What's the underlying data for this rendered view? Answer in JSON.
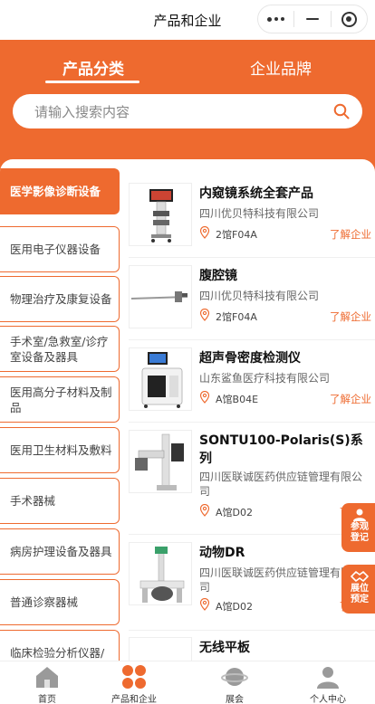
{
  "header": {
    "title": "产品和企业"
  },
  "tabs": {
    "products": "产品分类",
    "brands": "企业品牌"
  },
  "search": {
    "placeholder": "请输入搜索内容"
  },
  "categories": [
    "医学影像诊断设备",
    "医用电子仪器设备",
    "物理治疗及康复设备",
    "手术室/急救室/诊疗室设备及器具",
    "医用高分子材料及制品",
    "医用卫生材料及敷料",
    "手术器械",
    "病房护理设备及器具",
    "普通诊察器械",
    "临床检验分析仪器/"
  ],
  "products": [
    {
      "name": "内窥镜系统全套产品",
      "company": "四川优贝特科技有限公司",
      "location": "2馆F04A",
      "link": "了解企业"
    },
    {
      "name": "腹腔镜",
      "company": "四川优贝特科技有限公司",
      "location": "2馆F04A",
      "link": "了解企业"
    },
    {
      "name": "超声骨密度检测仪",
      "company": "山东鲨鱼医疗科技有限公司",
      "location": "A馆B04E",
      "link": "了解企业"
    },
    {
      "name": "SONTU100-Polaris(S)系列",
      "company": "四川医联诚医药供应链管理有限公司",
      "location": "A馆D02",
      "link": "了"
    },
    {
      "name": "动物DR",
      "company": "四川医联诚医药供应链管理有限公司",
      "location": "A馆D02",
      "link": "了"
    },
    {
      "name": "无线平板",
      "company": "",
      "location": "",
      "link": ""
    }
  ],
  "float_buttons": {
    "visit": "参观登记",
    "booth": "展位预定"
  },
  "tabbar": {
    "home": "首页",
    "products": "产品和企业",
    "expo": "展会",
    "me": "个人中心"
  },
  "colors": {
    "accent": "#ee6a2f"
  }
}
